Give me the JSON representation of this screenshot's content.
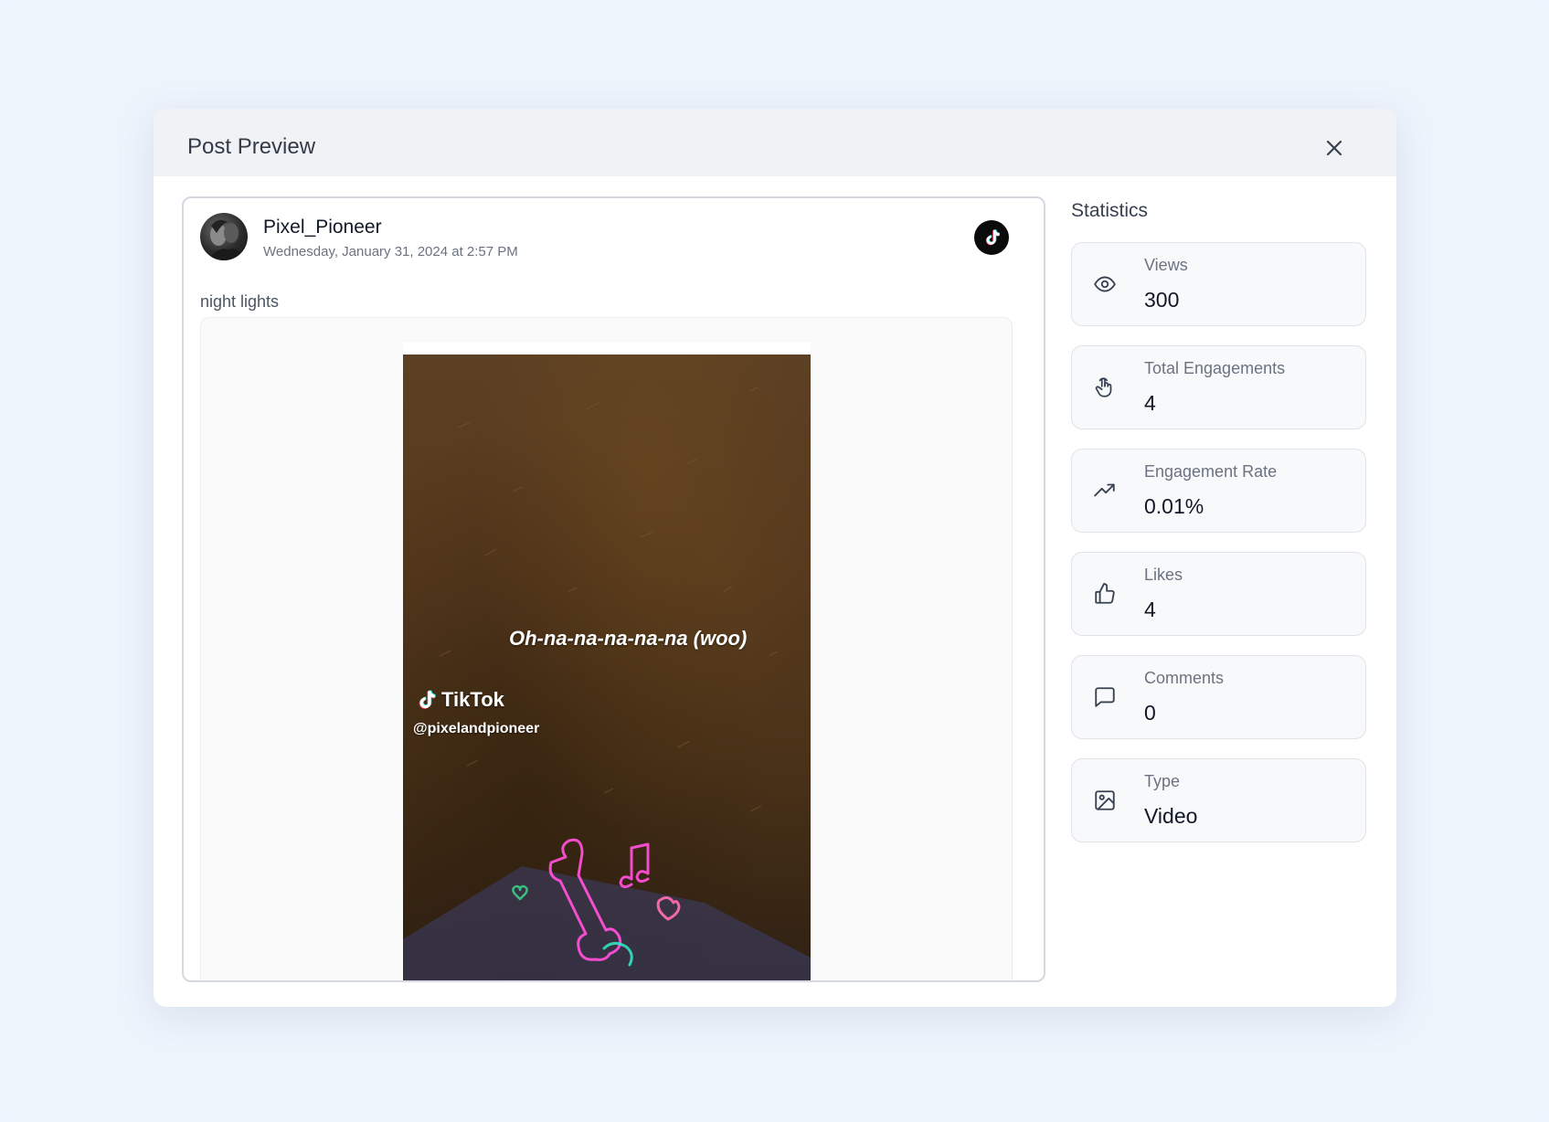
{
  "modal": {
    "title": "Post Preview"
  },
  "post": {
    "author": "Pixel_Pioneer",
    "date": "Wednesday, January 31, 2024 at 2:57 PM",
    "caption": "night lights",
    "platform_icon": "tiktok-icon",
    "video": {
      "lyric": "Oh-na-na-na-na-na (woo)",
      "watermark": "TikTok",
      "handle": "@pixelandpioneer"
    }
  },
  "statistics": {
    "title": "Statistics",
    "items": [
      {
        "label": "Views",
        "value": "300",
        "icon": "eye-icon"
      },
      {
        "label": "Total Engagements",
        "value": "4",
        "icon": "pointer-hand-icon"
      },
      {
        "label": "Engagement Rate",
        "value": "0.01%",
        "icon": "trending-up-icon"
      },
      {
        "label": "Likes",
        "value": "4",
        "icon": "thumbs-up-icon"
      },
      {
        "label": "Comments",
        "value": "0",
        "icon": "comment-icon"
      },
      {
        "label": "Type",
        "value": "Video",
        "icon": "image-icon"
      }
    ]
  },
  "colors": {
    "background": "#eef4fc",
    "header": "#f1f2f6",
    "card_border": "#dfe3ea",
    "text_dark": "#111827",
    "text_muted": "#6b7280"
  }
}
